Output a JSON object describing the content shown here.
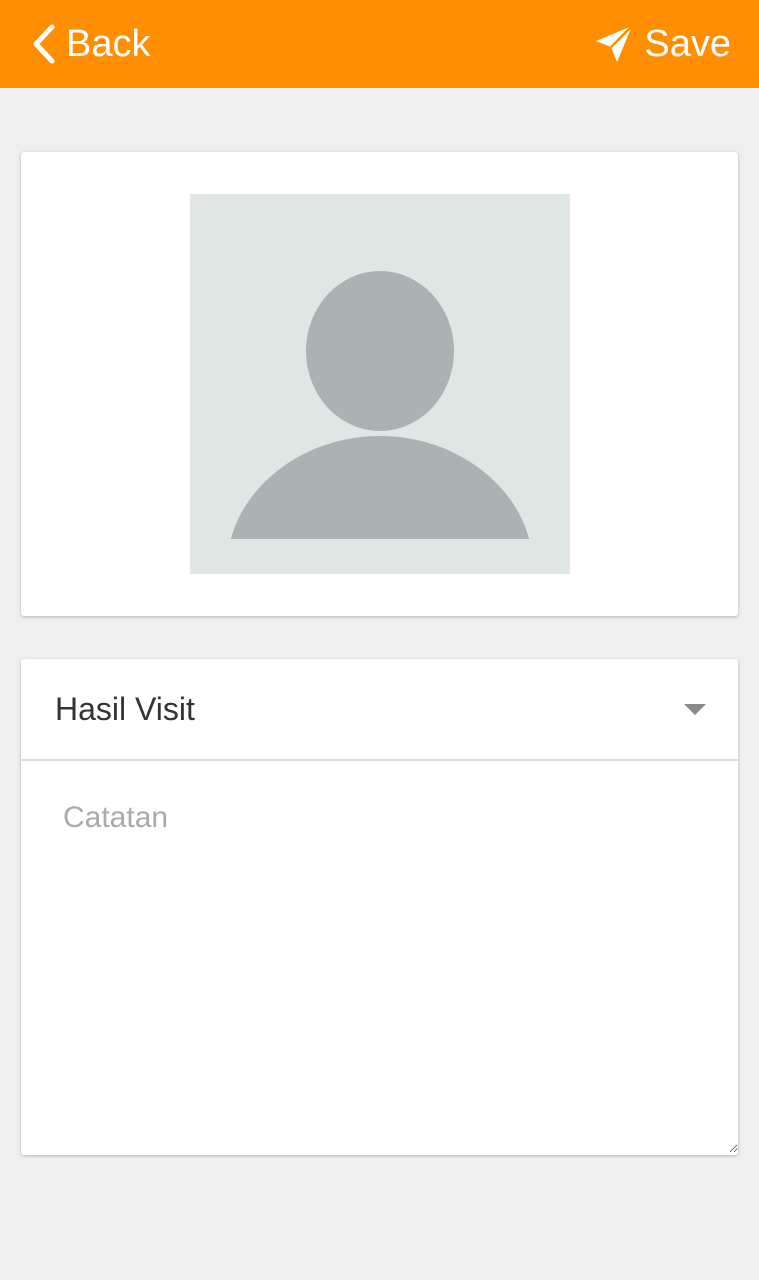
{
  "header": {
    "back_label": "Back",
    "save_label": "Save",
    "background": "#ff8f00"
  },
  "photo": {
    "icon": "person-silhouette-icon",
    "placeholder_bg": "#e0e6e4",
    "silhouette_color": "#aab2b3"
  },
  "form": {
    "result_select": {
      "selected_value": "Hasil Visit"
    },
    "notes": {
      "placeholder": "Catatan",
      "value": ""
    }
  }
}
